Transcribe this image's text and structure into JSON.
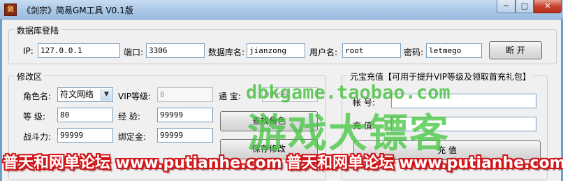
{
  "window": {
    "title": "《剑宗》简易GM工具 V0.1版",
    "icon_name": "game-logo-icon",
    "controls": {
      "minimize": "─",
      "maximize": "□",
      "close": "✕"
    }
  },
  "db_login": {
    "group_label": "数据库登陆",
    "ip_label": "IP:",
    "ip_value": "127.0.0.1",
    "port_label": "端口:",
    "port_value": "3306",
    "dbname_label": "数据库名:",
    "dbname_value": "jianzong",
    "user_label": "用户名:",
    "user_value": "root",
    "password_label": "密码:",
    "password_value": "letmego",
    "disconnect_button": "断  开"
  },
  "modify": {
    "group_label": "修改区",
    "role_label": "角色名:",
    "role_value": "符文网络",
    "vip_label": "VIP等级:",
    "vip_value": "8",
    "tongbao_label": "通  宝:",
    "tongbao_value": "99999",
    "level_label": "等  级:",
    "level_value": "80",
    "exp_label": "经  验:",
    "exp_value": "99999",
    "power_label": "战斗力:",
    "power_value": "99999",
    "bound_gold_label": "绑定金:",
    "bound_gold_value": "99999",
    "find_role_button": "查找角色",
    "save_button": "保存修改"
  },
  "recharge": {
    "group_label": "元宝充值【可用于提升VIP等级及领取首充礼包】",
    "account_label": "帐  号:",
    "account_value": "",
    "amount_label": "充  值:",
    "amount_value": "",
    "recharge_button": "充  值"
  },
  "watermark": {
    "url": "dbkgame.taobao.com",
    "brand": "游戏大镖客",
    "banner_left": "普天和网单论坛 www.putianhe.com",
    "banner_right": "普天和网单论坛 www.putianhe.com"
  },
  "colors": {
    "titlebar": "#aac7e6",
    "close_button": "#c8422c",
    "window_bg": "#f0f0f0",
    "watermark_green": "#40bc38",
    "banner_red": "#d2161a"
  }
}
